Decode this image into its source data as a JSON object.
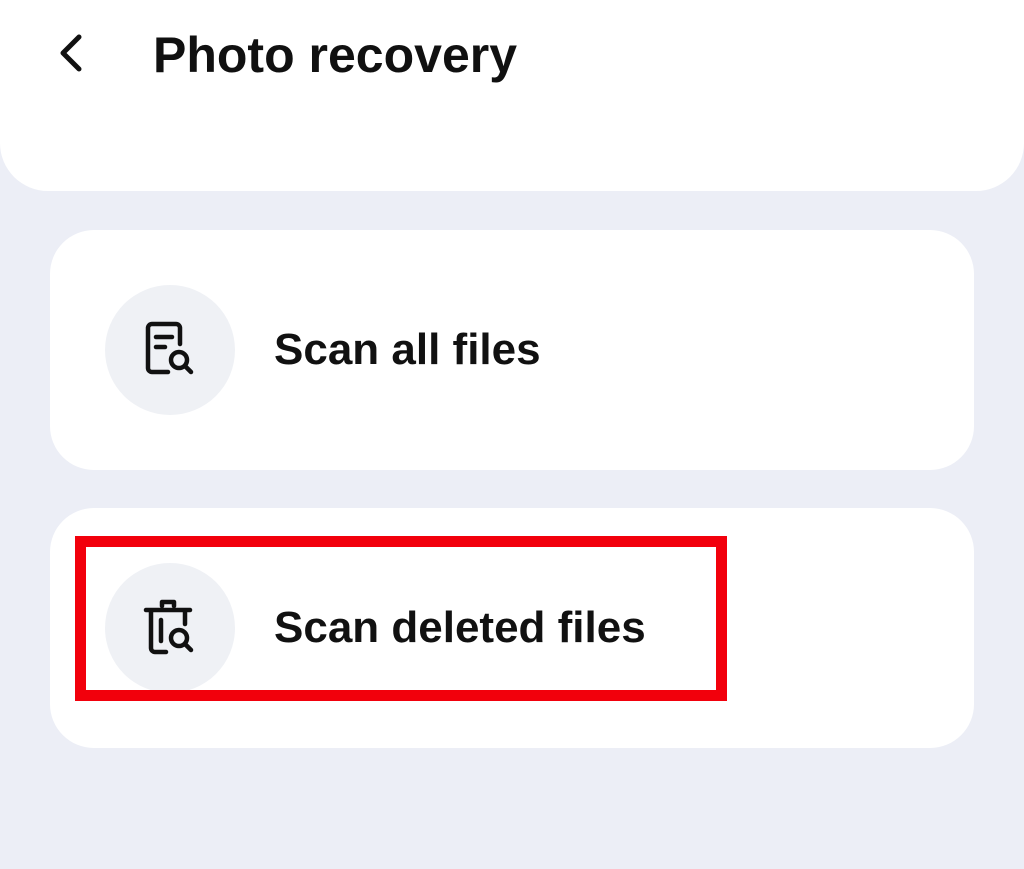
{
  "header": {
    "back_icon": "chevron-left-icon",
    "title": "Photo recovery"
  },
  "options": [
    {
      "label": "Scan all files",
      "icon": "file-search-icon"
    },
    {
      "label": "Scan deleted files",
      "icon": "trash-search-icon"
    }
  ],
  "highlight": {
    "color": "#f2000c",
    "target": "Scan deleted files"
  },
  "colors": {
    "background": "#eceef6",
    "card": "#ffffff",
    "icon_circle": "#eff1f5",
    "text": "#111111"
  }
}
